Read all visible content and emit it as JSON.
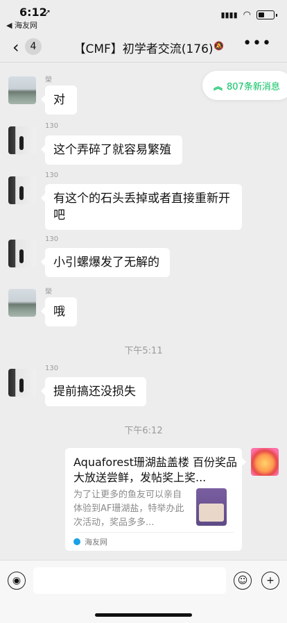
{
  "status": {
    "time": "6:12",
    "back_app": "◀ 海友网"
  },
  "nav": {
    "back_count": "4",
    "title": "【CMF】初学者交流(176)"
  },
  "new_messages": "807条新消息",
  "messages": [
    {
      "sender": "榮",
      "text": "对"
    },
    {
      "sender": "130",
      "text": "这个弄碎了就容易繁殖"
    },
    {
      "sender": "130",
      "text": "有这个的石头丢掉或者直接重新开吧"
    },
    {
      "sender": "130",
      "text": "小引螺爆发了无解的"
    },
    {
      "sender": "榮",
      "text": "哦"
    },
    {
      "sender": "130",
      "text": "提前搞还没损失"
    }
  ],
  "time_separators": [
    "下午5:11",
    "下午6:12"
  ],
  "card": {
    "title": "Aquaforest珊湖盐盖楼 百份奖品大放送尝鲜，发帖奖上奖...",
    "desc": "为了让更多的鱼友可以亲自体验到AF珊湖盐，特举办此次活动，奖品多多...",
    "source": "海友网"
  }
}
